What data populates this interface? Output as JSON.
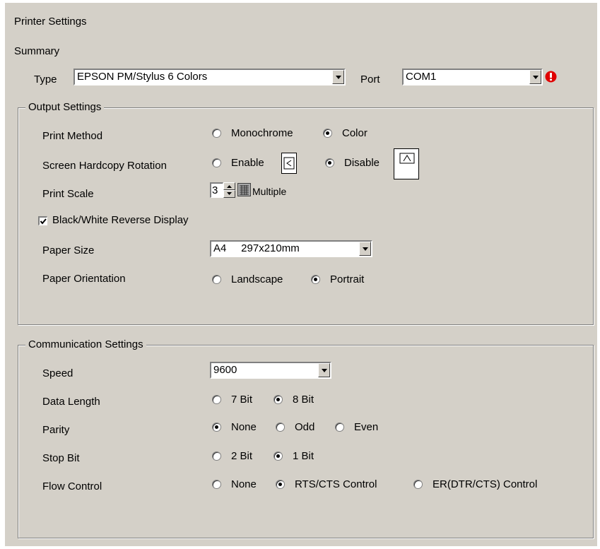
{
  "header": {
    "title": "Printer Settings",
    "section": "Summary"
  },
  "type": {
    "label": "Type",
    "value": "EPSON PM/Stylus 6 Colors"
  },
  "port": {
    "label": "Port",
    "value": "COM1"
  },
  "output": {
    "title": "Output Settings",
    "print_method": {
      "label": "Print Method",
      "options": [
        "Monochrome",
        "Color"
      ],
      "selected": "Color"
    },
    "rotation": {
      "label": "Screen Hardcopy Rotation",
      "options": [
        "Enable",
        "Disable"
      ],
      "selected": "Disable"
    },
    "print_scale": {
      "label": "Print Scale",
      "value": "3",
      "unit": "Multiple"
    },
    "bw_reverse": {
      "label": "Black/White Reverse Display",
      "checked": true
    },
    "paper_size": {
      "label": "Paper Size",
      "value": "A4     297x210mm"
    },
    "paper_orientation": {
      "label": "Paper Orientation",
      "options": [
        "Landscape",
        "Portrait"
      ],
      "selected": "Portrait"
    }
  },
  "comm": {
    "title": "Communication Settings",
    "speed": {
      "label": "Speed",
      "value": "9600"
    },
    "data_length": {
      "label": "Data Length",
      "options": [
        "7 Bit",
        "8 Bit"
      ],
      "selected": "8 Bit"
    },
    "parity": {
      "label": "Parity",
      "options": [
        "None",
        "Odd",
        "Even"
      ],
      "selected": "None"
    },
    "stop_bit": {
      "label": "Stop Bit",
      "options": [
        "2 Bit",
        "1 Bit"
      ],
      "selected": "1 Bit"
    },
    "flow_control": {
      "label": "Flow Control",
      "options": [
        "None",
        "RTS/CTS Control",
        "ER(DTR/CTS) Control"
      ],
      "selected": "RTS/CTS Control"
    }
  },
  "colors": {
    "panel": "#d4d0c8",
    "error_icon": "#e00000"
  }
}
